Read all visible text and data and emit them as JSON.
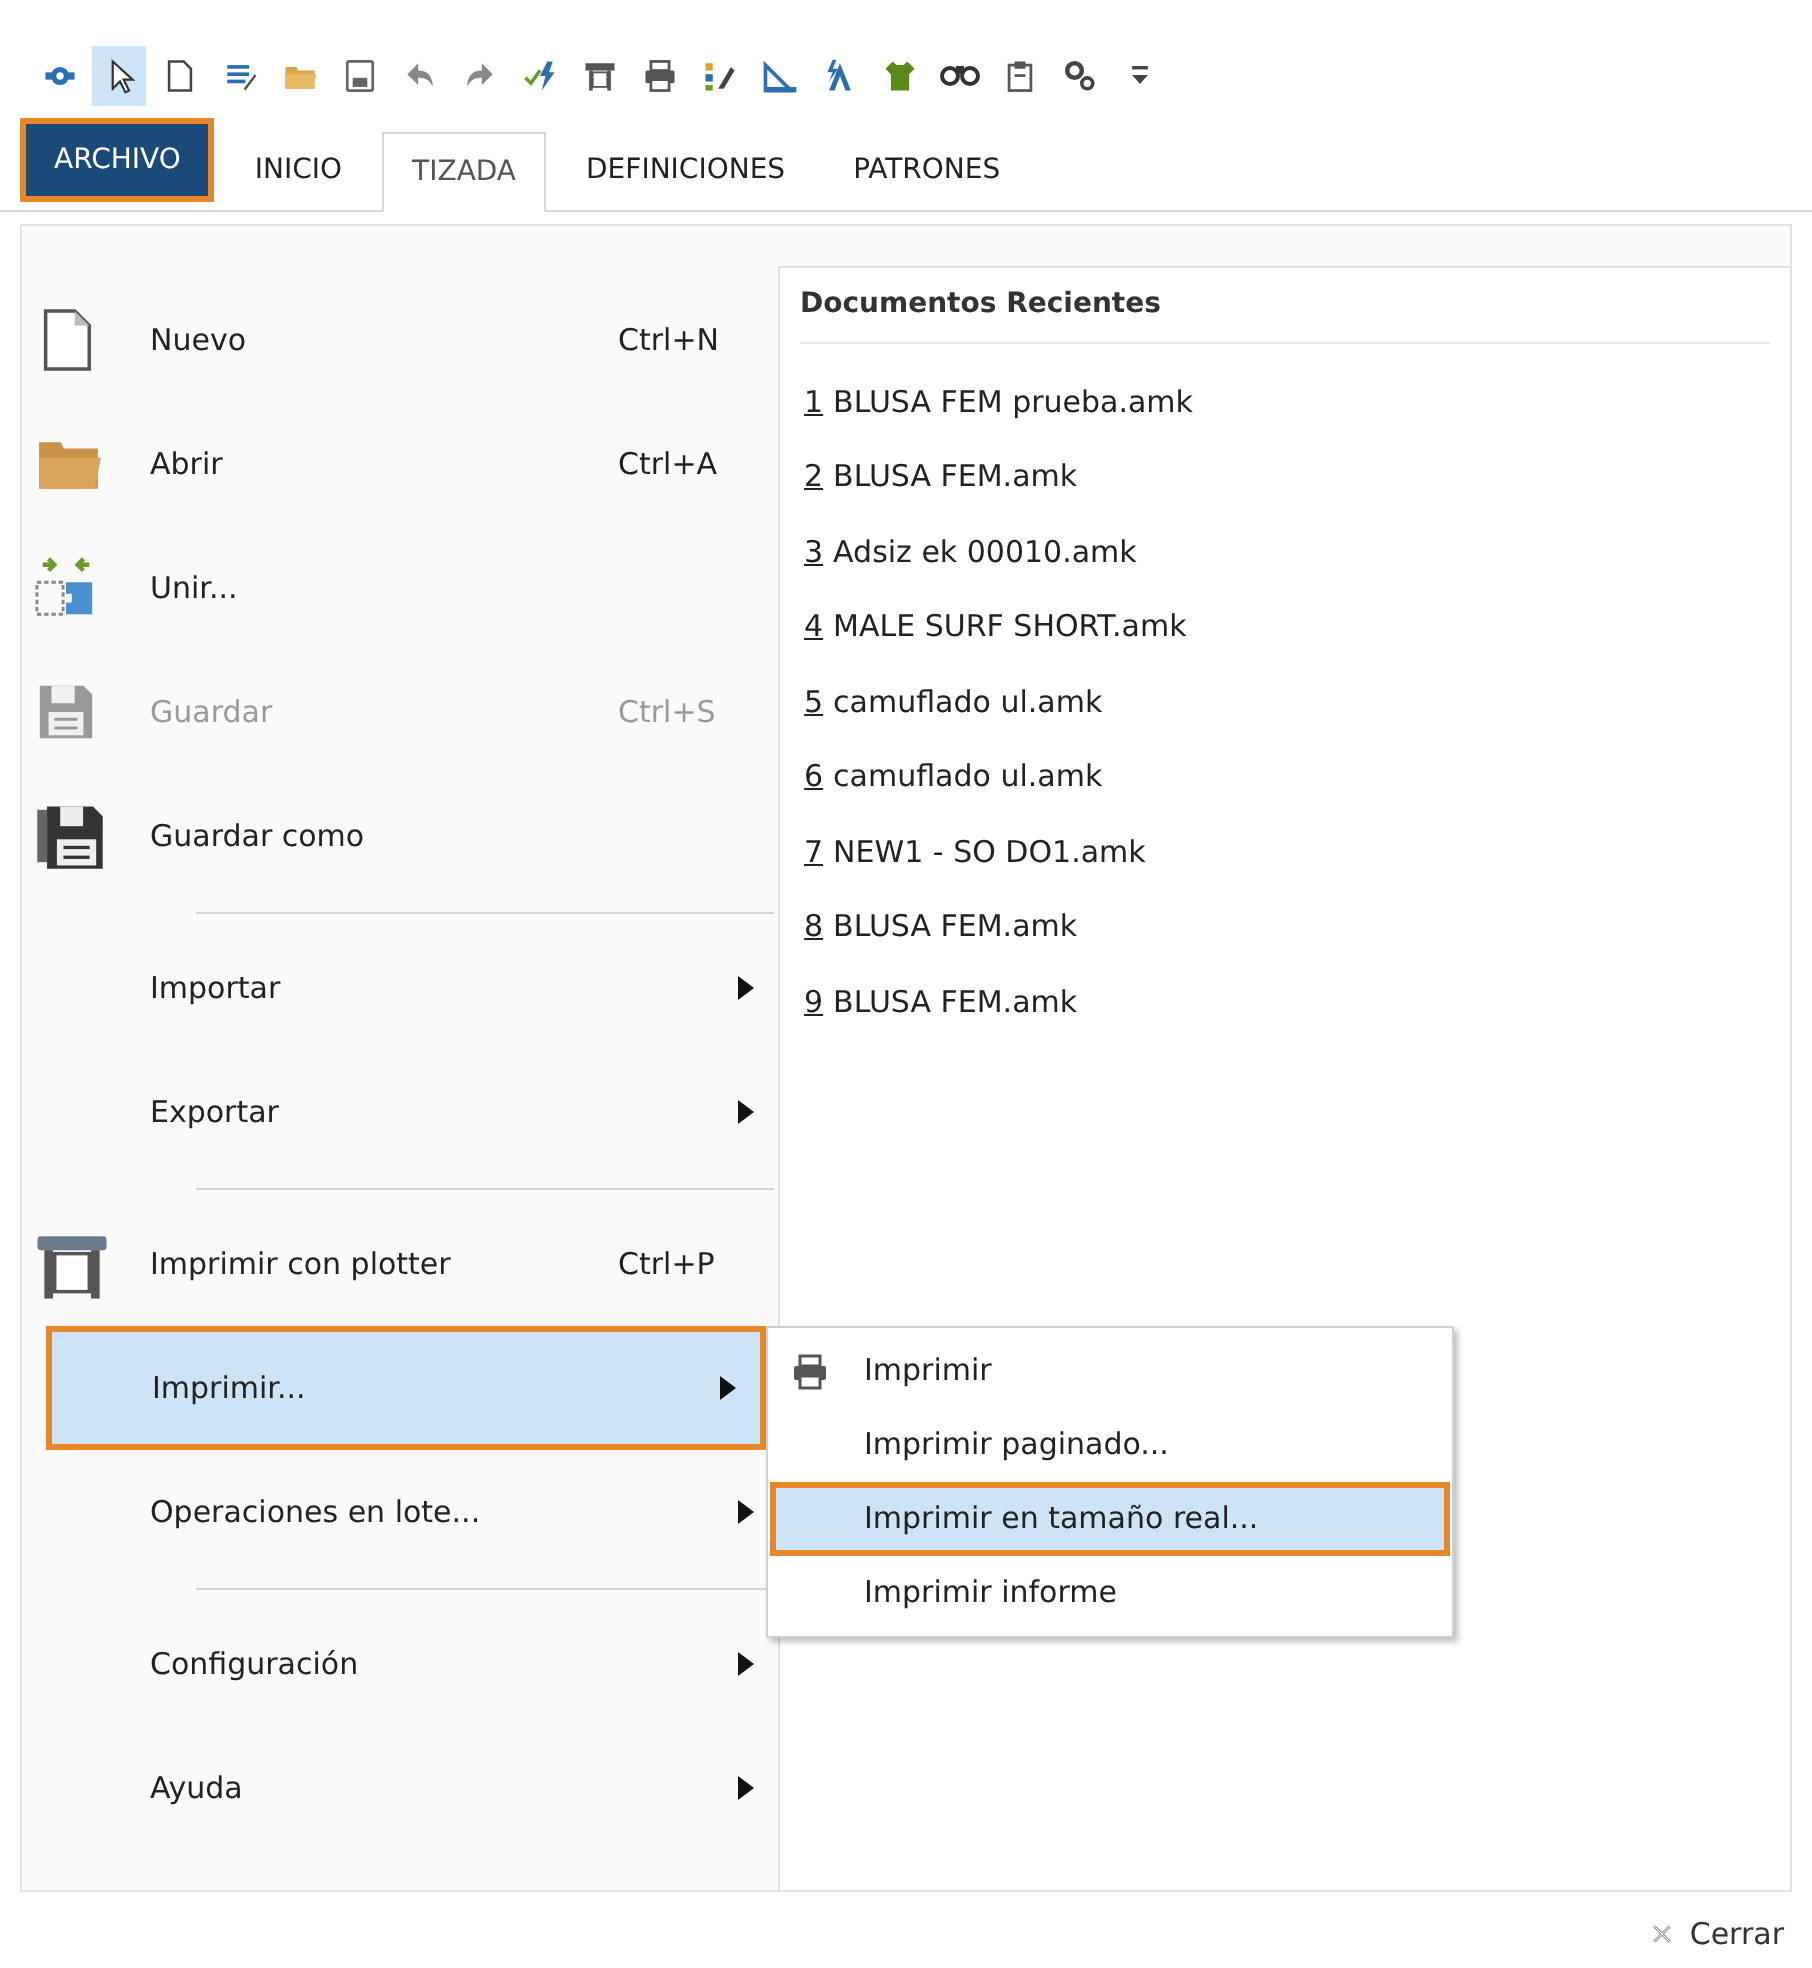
{
  "toolbar": [
    {
      "selected": false
    },
    {
      "selected": true
    },
    {
      "selected": false
    },
    {
      "selected": false
    },
    {
      "selected": false
    },
    {
      "selected": false
    },
    {
      "selected": false
    },
    {
      "selected": false
    },
    {
      "selected": false
    },
    {
      "selected": false
    },
    {
      "selected": false
    },
    {
      "selected": false
    },
    {
      "selected": false
    },
    {
      "selected": false
    },
    {
      "selected": false
    },
    {
      "selected": false
    },
    {
      "selected": false
    },
    {
      "selected": false
    },
    {
      "selected": false
    }
  ],
  "tabs": [
    {
      "label": "ARCHIVO",
      "selected": true,
      "kind": "file"
    },
    {
      "label": "INICIO",
      "selected": false,
      "kind": "ribbon"
    },
    {
      "label": "TIZADA",
      "selected": true,
      "kind": "ribbon"
    },
    {
      "label": "DEFINICIONES",
      "selected": false,
      "kind": "ribbon"
    },
    {
      "label": "PATRONES",
      "selected": false,
      "kind": "ribbon"
    }
  ],
  "menu": [
    {
      "kind": "command",
      "label": "Nuevo",
      "shortcut": "Ctrl+N",
      "disabled": false,
      "selected": false
    },
    {
      "kind": "command",
      "label": "Abrir",
      "shortcut": "Ctrl+A",
      "disabled": false,
      "selected": false
    },
    {
      "kind": "command",
      "label": "Unir...",
      "disabled": false,
      "selected": false
    },
    {
      "kind": "command",
      "label": "Guardar",
      "shortcut": "Ctrl+S",
      "disabled": true,
      "selected": false
    },
    {
      "kind": "command",
      "label": "Guardar como",
      "disabled": false,
      "selected": false
    },
    {
      "kind": "separator"
    },
    {
      "kind": "submenu",
      "label": "Importar",
      "disabled": false,
      "selected": false
    },
    {
      "kind": "submenu",
      "label": "Exportar",
      "disabled": false,
      "selected": false
    },
    {
      "kind": "separator"
    },
    {
      "kind": "command",
      "label": "Imprimir con plotter",
      "shortcut": "Ctrl+P",
      "disabled": false,
      "selected": false
    },
    {
      "kind": "submenu",
      "label": "Imprimir...",
      "disabled": false,
      "selected": true
    },
    {
      "kind": "submenu",
      "label": "Operaciones en lote...",
      "disabled": false,
      "selected": false
    },
    {
      "kind": "separator"
    },
    {
      "kind": "submenu",
      "label": "Configuración",
      "disabled": false,
      "selected": false
    },
    {
      "kind": "submenu",
      "label": "Ayuda",
      "disabled": false,
      "selected": false
    }
  ],
  "submenu": [
    {
      "label": "Imprimir",
      "selected": false,
      "icon": true
    },
    {
      "label": "Imprimir paginado...",
      "selected": false,
      "icon": false
    },
    {
      "label": "Imprimir en tamaño real...",
      "selected": true,
      "icon": false
    },
    {
      "label": "Imprimir informe",
      "selected": false,
      "icon": false
    }
  ],
  "recent": {
    "title": "Documentos Recientes",
    "items": [
      {
        "number": "1",
        "name": "BLUSA FEM prueba.amk"
      },
      {
        "number": "2",
        "name": "BLUSA FEM.amk"
      },
      {
        "number": "3",
        "name": "Adsiz ek 00010.amk"
      },
      {
        "number": "4",
        "name": "MALE SURF SHORT.amk"
      },
      {
        "number": "5",
        "name": "camuflado ul.amk"
      },
      {
        "number": "6",
        "name": "camuflado ul.amk"
      },
      {
        "number": "7",
        "name": "NEW1 - SO DO1.amk"
      },
      {
        "number": "8",
        "name": "BLUSA FEM.amk"
      },
      {
        "number": "9",
        "name": "BLUSA FEM.amk"
      }
    ]
  },
  "close": {
    "label": "Cerrar"
  }
}
